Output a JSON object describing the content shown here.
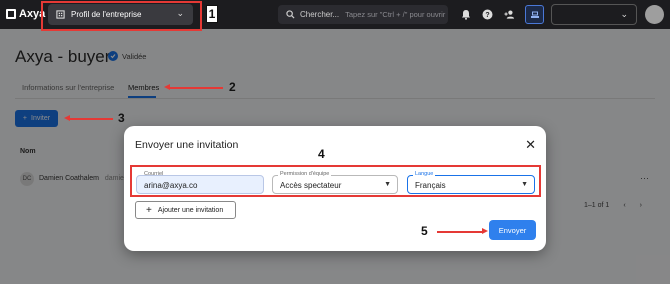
{
  "topbar": {
    "logo_text": "Axya",
    "company_select_label": "Profil de l'entreprise",
    "search_label": "Chercher...",
    "search_placeholder": "Tapez sur \"Ctrl + /\" pour ouvrir",
    "icons": [
      "bell-icon",
      "help-icon",
      "add-user-icon"
    ]
  },
  "page": {
    "title": "Axya - buyer",
    "verified_label": "Validée",
    "tabs": [
      {
        "label": "Informations sur l'entreprise"
      },
      {
        "label": "Membres"
      }
    ],
    "active_tab": "Membres",
    "invite_button": "Inviter",
    "table": {
      "header": "Nom",
      "rows": [
        {
          "initials": "DC",
          "name": "Damien Coathalem",
          "extra": "damien@axya.co"
        }
      ]
    },
    "pagination": "1–1 of 1"
  },
  "modal": {
    "title": "Envoyer une invitation",
    "email_label": "Courriel",
    "email_value": "arina@axya.co",
    "permission_label": "Permission d'équipe",
    "permission_value": "Accès spectateur",
    "language_label": "Langue",
    "language_value": "Français",
    "add_invitation": "Ajouter une invitation",
    "send_button": "Envoyer"
  },
  "annotations": [
    "1",
    "2",
    "3",
    "4",
    "5"
  ],
  "colors": {
    "accent": "#1a73e8",
    "annotation": "#e53935",
    "topbar": "#1c1c1f"
  }
}
